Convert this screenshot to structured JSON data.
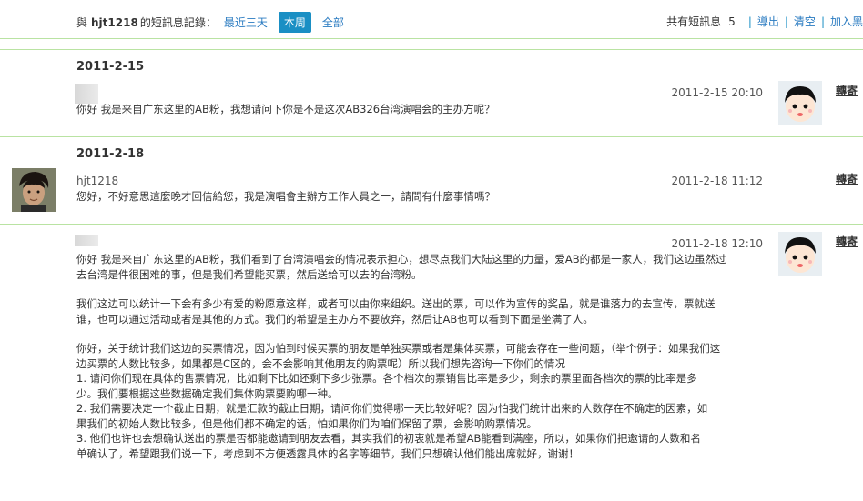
{
  "header": {
    "prefix": "與",
    "username": "hjt1218",
    "suffix": "的短訊息記錄：",
    "filters": [
      "最近三天",
      "本周",
      "全部"
    ],
    "active_filter": "本周",
    "count_label": "共有短訊息",
    "count": "5",
    "actions": [
      "導出",
      "清空",
      "加入黑"
    ]
  },
  "dates": [
    "2011-2-15",
    "2011-2-18"
  ],
  "messages": [
    {
      "time": "2011-2-15 20:10",
      "text": "你好 我是来自广东这里的AB粉，我想请问下你是不是这次AB326台湾演唱会的主办方呢？",
      "reply": "轉寄"
    },
    {
      "sender": "hjt1218",
      "time": "2011-2-18 11:12",
      "text": "您好，不好意思這麼晚才回信給您，我是演唱會主辦方工作人員之一，請問有什麼事情嗎？",
      "reply": "轉寄"
    },
    {
      "time": "2011-2-18 12:10",
      "paragraphs": [
        [
          "你好 我是来自广东这里的AB粉，我们看到了台湾演唱会的情况表示担心，想尽点我们大陆这里的力量，爱AB的都是一家人，我们这边虽然过",
          "去台湾是件很困难的事，但是我们希望能买票，然后送给可以去的台湾粉。"
        ],
        [
          "我们这边可以统计一下会有多少有爱的粉愿意这样，或者可以由你来组织。送出的票，可以作为宣传的奖品，就是谁落力的去宣传，票就送",
          "谁，也可以通过活动或者是其他的方式。我们的希望是主办方不要放弃，然后让AB也可以看到下面是坐满了人。"
        ],
        [
          "你好，关于统计我们这边的买票情况，因为怕到时候买票的朋友是单独买票或者是集体买票，可能会存在一些问题，（举个例子：如果我们这",
          "边买票的人数比较多，如果都是C区的，会不会影响其他朋友的购票呢）所以我们想先咨询一下你们的情况",
          "1.        请问你们现在具体的售票情况，比如剩下比如还剩下多少张票。各个档次的票销售比率是多少，剩余的票里面各档次的票的比率是多",
          "少。我们要根据这些数据确定我们集体购票要购哪一种。",
          "2.        我们需要决定一个截止日期，就是汇款的截止日期，请问你们觉得哪一天比较好呢？因为怕我们统计出来的人数存在不确定的因素，如",
          "果我们的初始人数比较多，但是他们都不确定的话，怕如果你们为咱们保留了票，会影响购票情况。",
          "3.        他们也许也会想确认送出的票是否都能邀请到朋友去看，其实我们的初衷就是希望AB能看到满座，所以，如果你们把邀请的人数和名",
          "单确认了，希望跟我们说一下，考虑到不方便透露具体的名字等细节，我们只想确认他们能出席就好，谢谢！"
        ]
      ],
      "reply": "轉寄"
    }
  ]
}
